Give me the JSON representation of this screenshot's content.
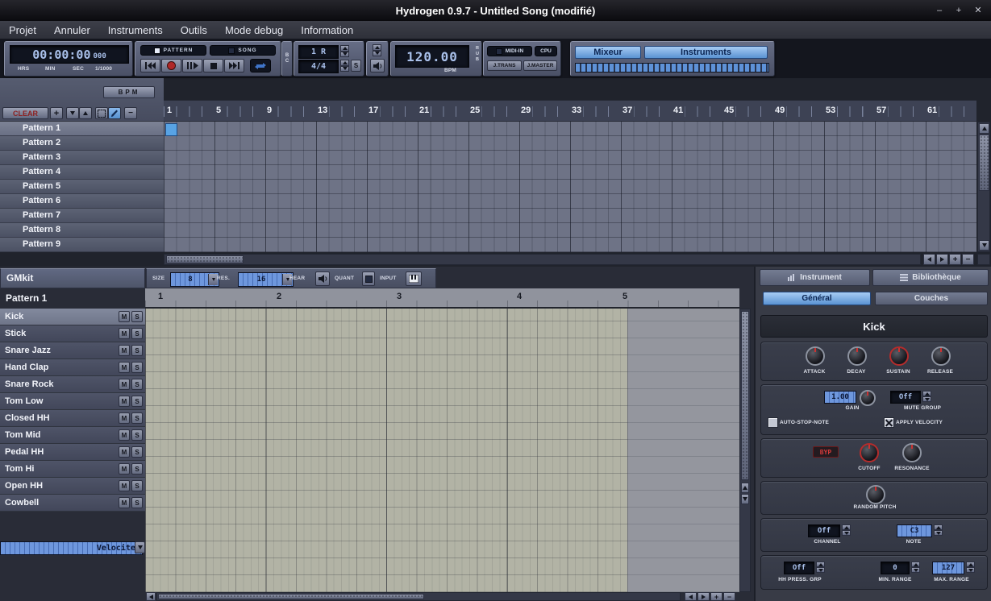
{
  "titlebar": {
    "title": "Hydrogen 0.9.7 - Untitled Song (modifié)",
    "minimize": "–",
    "maximize": "+",
    "close": "✕"
  },
  "menu": {
    "items": [
      "Projet",
      "Annuler",
      "Instruments",
      "Outils",
      "Mode debug",
      "Information"
    ]
  },
  "toolbar": {
    "time": {
      "value": "00:00:00",
      "ms": "000",
      "hrs": "HRS",
      "min": "MIN",
      "sec": "SEC",
      "thousandth": "1/1000"
    },
    "mode": {
      "pattern": "PATTERN",
      "song": "SONG"
    },
    "beatcounter": {
      "label": "BC",
      "display_top": "1 R",
      "display_bottom": "4/4",
      "set": "S"
    },
    "tempo": {
      "value": "120.00",
      "unit": "BPM",
      "rub": "RUB"
    },
    "midi": {
      "in": "MIDI-IN",
      "cpu": "CPU",
      "jtrans": "J.TRANS",
      "jmaster": "J.MASTER"
    },
    "show": {
      "mixer": "Mixeur",
      "instruments": "Instruments"
    }
  },
  "songEditor": {
    "bpm": "BPM",
    "clear": "CLEAR",
    "add": "+",
    "timeline": [
      "1",
      "5",
      "9",
      "13",
      "17",
      "21",
      "25",
      "29",
      "33",
      "37",
      "41",
      "45",
      "49",
      "53",
      "57",
      "61"
    ],
    "patterns": [
      "Pattern 1",
      "Pattern 2",
      "Pattern 3",
      "Pattern 4",
      "Pattern 5",
      "Pattern 6",
      "Pattern 7",
      "Pattern 8",
      "Pattern 9"
    ]
  },
  "patternEditor": {
    "kit": "GMkit",
    "size": {
      "label": "SIZE",
      "value": "8"
    },
    "res": {
      "label": "RES.",
      "value": "16"
    },
    "hear": "HEAR",
    "quant": "QUANT",
    "input": "INPUT",
    "pattern": "Pattern 1",
    "ruler": [
      "1",
      "2",
      "3",
      "4",
      "5"
    ],
    "instruments": [
      "Kick",
      "Stick",
      "Snare Jazz",
      "Hand Clap",
      "Snare Rock",
      "Tom Low",
      "Closed HH",
      "Tom Mid",
      "Pedal HH",
      "Tom Hi",
      "Open HH",
      "Cowbell"
    ],
    "mute": "M",
    "solo": "S",
    "property": "Velocite"
  },
  "instrument": {
    "tab_instrument": "Instrument",
    "tab_library": "Bibliothèque",
    "tab_general": "Général",
    "tab_layers": "Couches",
    "name": "Kick",
    "attack": "ATTACK",
    "decay": "DECAY",
    "sustain": "SUSTAIN",
    "release": "RELEASE",
    "gain": {
      "value": "1.00",
      "label": "GAIN"
    },
    "mute_group": {
      "value": "Off",
      "label": "MUTE GROUP"
    },
    "auto_stop": "AUTO-STOP-NOTE",
    "apply_velocity": "APPLY VELOCITY",
    "bypass": "BYP",
    "cutoff": "CUTOFF",
    "resonance": "RESONANCE",
    "random_pitch": "RANDOM PITCH",
    "channel": {
      "value": "Off",
      "label": "CHANNEL"
    },
    "note": {
      "value": "C3",
      "label": "NOTE"
    },
    "hh": {
      "value": "Off",
      "label": "HH PRESS. GRP"
    },
    "min": {
      "value": "0",
      "label": "MIN. RANGE"
    },
    "max": {
      "value": "127",
      "label": "MAX. RANGE"
    }
  },
  "ui": {
    "plus": "+",
    "minus": "−"
  },
  "colors": {
    "accent_blue": "#5a93d2",
    "lcd_text": "#a9c0ea",
    "record_red": "#b02828",
    "selected_cell": "#58a3e4"
  }
}
